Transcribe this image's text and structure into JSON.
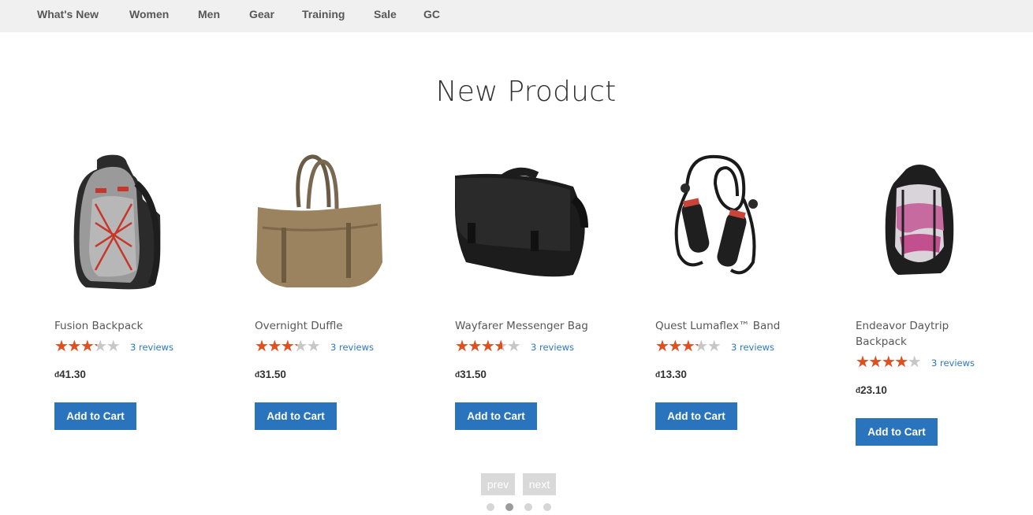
{
  "nav": {
    "items": [
      "What's New",
      "Women",
      "Men",
      "Gear",
      "Training",
      "Sale",
      "GC"
    ]
  },
  "section": {
    "title": "New Product"
  },
  "products": [
    {
      "name": "Fusion Backpack",
      "rating_percent": 60,
      "reviews": "3 reviews",
      "currency": "đ",
      "price": "41.30",
      "button": "Add to Cart"
    },
    {
      "name": "Overnight Duffle",
      "rating_percent": 60,
      "reviews": "3 reviews",
      "currency": "đ",
      "price": "31.50",
      "button": "Add to Cart"
    },
    {
      "name": "Wayfarer Messenger Bag",
      "rating_percent": 67,
      "reviews": "3 reviews",
      "currency": "đ",
      "price": "31.50",
      "button": "Add to Cart"
    },
    {
      "name": "Quest Lumaflex™ Band",
      "rating_percent": 60,
      "reviews": "3 reviews",
      "currency": "đ",
      "price": "13.30",
      "button": "Add to Cart"
    },
    {
      "name": "Endeavor Daytrip Backpack",
      "rating_percent": 73,
      "reviews": "3 reviews",
      "currency": "đ",
      "price": "23.10",
      "button": "Add to Cart"
    }
  ],
  "pager": {
    "prev": "prev",
    "next": "next",
    "dots": 4,
    "active_dot": 1
  },
  "colors": {
    "star_filled": "#e24e1e",
    "star_empty": "#c7c7c7",
    "button": "#2a73bd",
    "link": "#2e78c0",
    "nav_bg": "#f0f0f0"
  }
}
